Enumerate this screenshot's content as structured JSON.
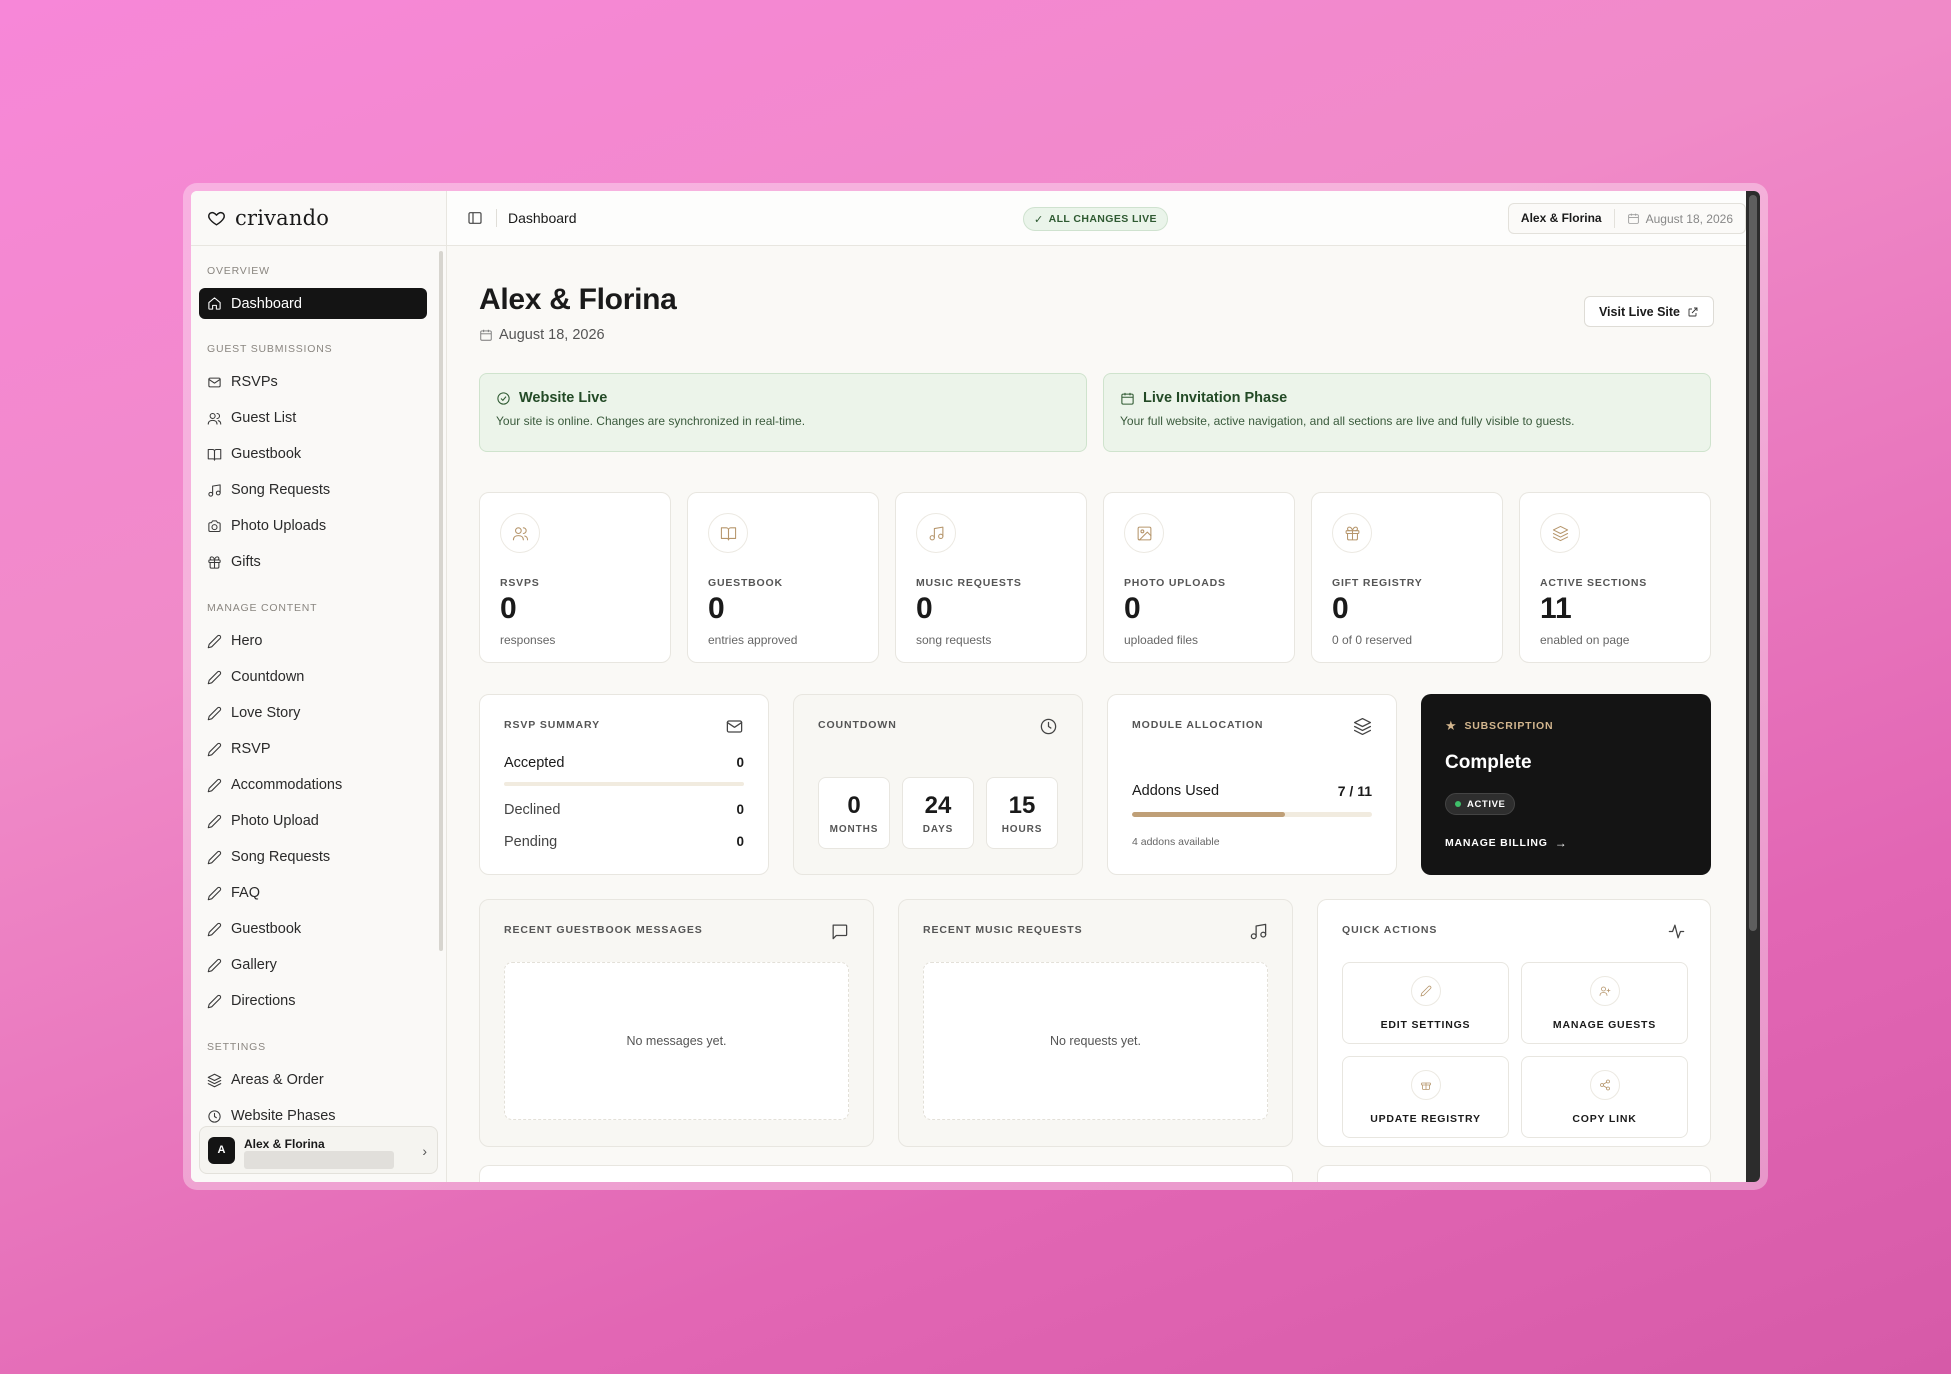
{
  "brand": {
    "name": "crivando",
    "icon": "heart-icon"
  },
  "sidebar": {
    "overview_label": "OVERVIEW",
    "dashboard": "Dashboard",
    "guest_submissions_label": "GUEST SUBMISSIONS",
    "guest_items": [
      {
        "label": "RSVPs",
        "icon": "mail-icon"
      },
      {
        "label": "Guest List",
        "icon": "users-icon"
      },
      {
        "label": "Guestbook",
        "icon": "book-icon"
      },
      {
        "label": "Song Requests",
        "icon": "music-icon"
      },
      {
        "label": "Photo Uploads",
        "icon": "camera-icon"
      },
      {
        "label": "Gifts",
        "icon": "gift-icon"
      }
    ],
    "manage_content_label": "MANAGE CONTENT",
    "content_items": [
      "Hero",
      "Countdown",
      "Love Story",
      "RSVP",
      "Accommodations",
      "Photo Upload",
      "Song Requests",
      "FAQ",
      "Guestbook",
      "Gallery",
      "Directions"
    ],
    "settings_label": "SETTINGS",
    "settings_items": [
      "Areas & Order",
      "Website Phases"
    ],
    "user": {
      "initial": "A",
      "name": "Alex & Florina"
    }
  },
  "topbar": {
    "crumb": "Dashboard",
    "status_pill": "ALL CHANGES LIVE",
    "couple": "Alex & Florina",
    "date": "August 18, 2026"
  },
  "hero": {
    "title": "Alex & Florina",
    "date": "August 18, 2026",
    "visit_button": "Visit Live Site"
  },
  "banners": {
    "live": {
      "title": "Website Live",
      "desc": "Your site is online. Changes are synchronized in real-time."
    },
    "phase": {
      "title": "Live Invitation Phase",
      "desc": "Your full website, active navigation, and all sections are live and fully visible to guests."
    }
  },
  "stats": [
    {
      "label": "RSVPS",
      "value": "0",
      "sub": "responses",
      "icon": "users-icon"
    },
    {
      "label": "GUESTBOOK",
      "value": "0",
      "sub": "entries approved",
      "icon": "book-icon"
    },
    {
      "label": "MUSIC REQUESTS",
      "value": "0",
      "sub": "song requests",
      "icon": "music-icon"
    },
    {
      "label": "PHOTO UPLOADS",
      "value": "0",
      "sub": "uploaded files",
      "icon": "image-icon"
    },
    {
      "label": "GIFT REGISTRY",
      "value": "0",
      "sub": "0 of 0 reserved",
      "icon": "gift-icon"
    },
    {
      "label": "ACTIVE SECTIONS",
      "value": "11",
      "sub": "enabled on page",
      "icon": "layers-icon"
    }
  ],
  "rsvp_summary": {
    "title": "RSVP SUMMARY",
    "accepted_label": "Accepted",
    "accepted": "0",
    "declined_label": "Declined",
    "declined": "0",
    "pending_label": "Pending",
    "pending": "0"
  },
  "countdown": {
    "title": "COUNTDOWN",
    "months": "0",
    "months_label": "MONTHS",
    "days": "24",
    "days_label": "DAYS",
    "hours": "15",
    "hours_label": "HOURS"
  },
  "allocation": {
    "title": "MODULE ALLOCATION",
    "label": "Addons Used",
    "value": "7 / 11",
    "fill_fraction": 0.636,
    "note": "4 addons available"
  },
  "subscription": {
    "label": "SUBSCRIPTION",
    "title": "Complete",
    "badge": "ACTIVE",
    "link": "MANAGE BILLING"
  },
  "guestbook_messages": {
    "title": "RECENT GUESTBOOK MESSAGES",
    "empty": "No messages yet."
  },
  "music_requests": {
    "title": "RECENT MUSIC REQUESTS",
    "empty": "No requests yet."
  },
  "quick_actions": {
    "title": "QUICK ACTIONS",
    "items": [
      {
        "label": "EDIT SETTINGS",
        "icon": "pencil-icon"
      },
      {
        "label": "MANAGE GUESTS",
        "icon": "user-plus-icon"
      },
      {
        "label": "UPDATE REGISTRY",
        "icon": "gift-icon"
      },
      {
        "label": "COPY LINK",
        "icon": "share-icon"
      }
    ]
  },
  "colors": {
    "accent": "#bf9f77",
    "live_green": "#2f5a32",
    "dark": "#141414"
  }
}
